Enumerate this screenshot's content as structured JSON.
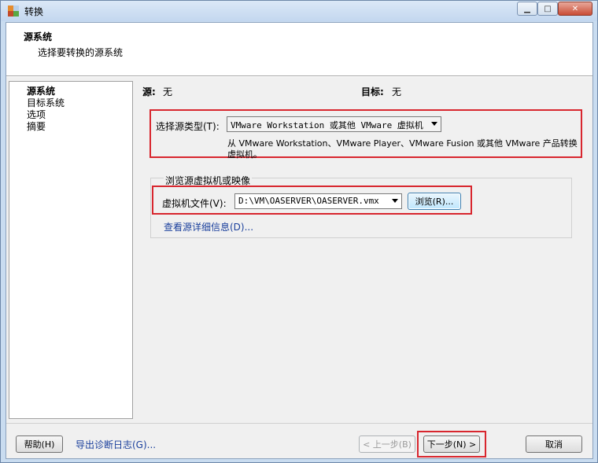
{
  "window": {
    "title": "转换"
  },
  "header": {
    "title": "源系统",
    "subtitle": "选择要转换的源系统"
  },
  "nav": {
    "items": [
      {
        "label": "源系统",
        "active": true
      },
      {
        "label": "目标系统",
        "active": false
      },
      {
        "label": "选项",
        "active": false
      },
      {
        "label": "摘要",
        "active": false
      }
    ]
  },
  "summary": {
    "source_label": "源:",
    "source_value": "无",
    "target_label": "目标:",
    "target_value": "无"
  },
  "source_type": {
    "label": "选择源类型(T):",
    "selected": "VMware Workstation 或其他 VMware 虚拟机",
    "description": "从 VMware Workstation、VMware Player、VMware Fusion 或其他 VMware 产品转换虚拟机。"
  },
  "browse_group": {
    "title": "浏览源虚拟机或映像",
    "file_label": "虚拟机文件(V):",
    "file_value": "D:\\VM\\OASERVER\\OASERVER.vmx",
    "browse_label": "浏览(R)...",
    "details_link": "查看源详细信息(D)..."
  },
  "footer": {
    "help_label": "帮助(H)",
    "export_link": "导出诊断日志(G)...",
    "back_label": "< 上一步(B)",
    "next_label": "下一步(N) >",
    "cancel_label": "取消"
  },
  "colors": {
    "highlight_box": "#d8262e",
    "link": "#1a3f9c"
  }
}
